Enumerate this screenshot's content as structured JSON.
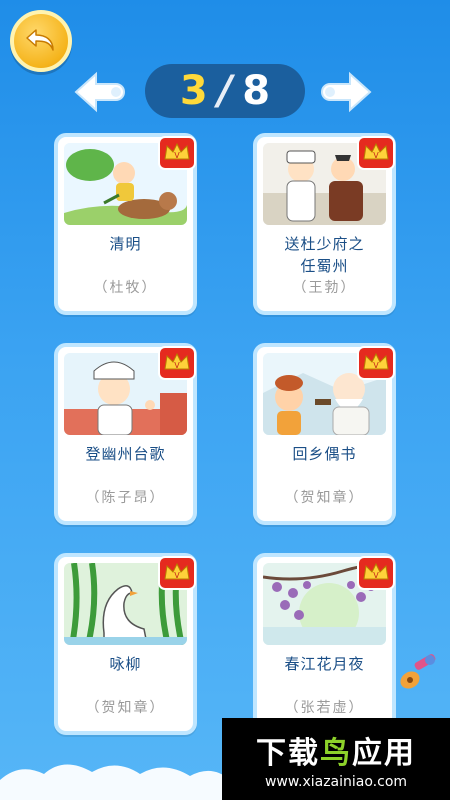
{
  "pager": {
    "current": "3",
    "separator": "/",
    "total": "8"
  },
  "cards": [
    {
      "title": "清明",
      "title2": "",
      "author": "（杜牧）"
    },
    {
      "title": "送杜少府之",
      "title2": "任蜀州",
      "author": "（王勃）"
    },
    {
      "title": "登幽州台歌",
      "title2": "",
      "author": "（陈子昂）"
    },
    {
      "title": "回乡偶书",
      "title2": "",
      "author": "（贺知章）"
    },
    {
      "title": "咏柳",
      "title2": "",
      "author": "（贺知章）"
    },
    {
      "title": "春江花月夜",
      "title2": "",
      "author": "（张若虚）"
    }
  ],
  "badge": {
    "letter": "V"
  },
  "watermark": {
    "brand_a": "下载",
    "brand_b": "鸟",
    "brand_c": "应用",
    "url": "www.xiazainiao.com"
  },
  "colors": {
    "background": "#3ba3f2",
    "card_border": "#bfe6ff",
    "title": "#1b4f87",
    "author": "#9a9a9a",
    "pager_bg": "#1b5f9e",
    "pager_current": "#ffd93a",
    "back_button": "#f5b41c"
  }
}
